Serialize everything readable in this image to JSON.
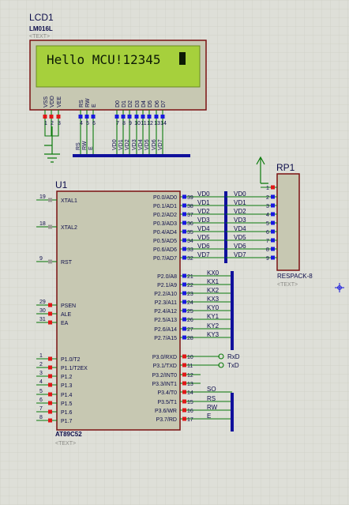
{
  "colors": {
    "background": "#dedfd8",
    "grid": "#cdcfc4",
    "body": "#c7c8b2",
    "body_border": "#7a1111",
    "wire": "#0b7a0b",
    "bus": "#10109c",
    "pin_red": "#e01818",
    "pin_blue": "#1818e0",
    "lcd_screen": "#a6d03c",
    "lcd_text": "#0d1a05",
    "text": "#0c0c4a",
    "muted": "#8b8b86"
  },
  "lcd": {
    "ref": "LCD1",
    "model": "LM016L",
    "text_placeholder": "<TEXT>",
    "display": "Hello MCU!12345",
    "pin_labels": [
      "VSS",
      "VDD",
      "VEE",
      "RS",
      "RW",
      "E",
      "D0",
      "D1",
      "D2",
      "D3",
      "D4",
      "D5",
      "D6",
      "D7"
    ],
    "pin_numbers": [
      "1",
      "2",
      "3",
      "4",
      "5",
      "6",
      "7",
      "8",
      "9",
      "10",
      "11",
      "12",
      "13",
      "14"
    ],
    "net_labels": [
      "RS",
      "RW",
      "E",
      "VD0",
      "VD1",
      "VD2",
      "VD3",
      "VD4",
      "VD5",
      "VD6",
      "VD7"
    ]
  },
  "mcu": {
    "ref": "U1",
    "model": "AT89C52",
    "text_placeholder": "<TEXT>",
    "left_pins": [
      {
        "num": "19",
        "name": "XTAL1"
      },
      {
        "num": "18",
        "name": "XTAL2"
      },
      {
        "num": "9",
        "name": "RST"
      },
      {
        "num": "29",
        "name": "PSEN"
      },
      {
        "num": "30",
        "name": "ALE"
      },
      {
        "num": "31",
        "name": "EA"
      },
      {
        "num": "1",
        "name": "P1.0/T2"
      },
      {
        "num": "2",
        "name": "P1.1/T2EX"
      },
      {
        "num": "3",
        "name": "P1.2"
      },
      {
        "num": "4",
        "name": "P1.3"
      },
      {
        "num": "5",
        "name": "P1.4"
      },
      {
        "num": "6",
        "name": "P1.5"
      },
      {
        "num": "7",
        "name": "P1.6"
      },
      {
        "num": "8",
        "name": "P1.7"
      }
    ],
    "right_pins": [
      {
        "num": "39",
        "name": "P0.0/AD0",
        "net": "VD0"
      },
      {
        "num": "38",
        "name": "P0.1/AD1",
        "net": "VD1"
      },
      {
        "num": "37",
        "name": "P0.2/AD2",
        "net": "VD2"
      },
      {
        "num": "36",
        "name": "P0.3/AD3",
        "net": "VD3"
      },
      {
        "num": "35",
        "name": "P0.4/AD4",
        "net": "VD4"
      },
      {
        "num": "34",
        "name": "P0.5/AD5",
        "net": "VD5"
      },
      {
        "num": "33",
        "name": "P0.6/AD6",
        "net": "VD6"
      },
      {
        "num": "32",
        "name": "P0.7/AD7",
        "net": "VD7"
      },
      {
        "num": "21",
        "name": "P2.0/A8",
        "net": "KX0"
      },
      {
        "num": "22",
        "name": "P2.1/A9",
        "net": "KX1"
      },
      {
        "num": "23",
        "name": "P2.2/A10",
        "net": "KX2"
      },
      {
        "num": "24",
        "name": "P2.3/A11",
        "net": "KX3"
      },
      {
        "num": "25",
        "name": "P2.4/A12",
        "net": "KY0"
      },
      {
        "num": "26",
        "name": "P2.5/A13",
        "net": "KY1"
      },
      {
        "num": "27",
        "name": "P2.6/A14",
        "net": "KY2"
      },
      {
        "num": "28",
        "name": "P2.7/A15",
        "net": "KY3"
      },
      {
        "num": "10",
        "name": "P3.0/RXD",
        "net": "RxD"
      },
      {
        "num": "11",
        "name": "P3.1/TXD",
        "net": "TxD"
      },
      {
        "num": "12",
        "name": "P3.2/INT0",
        "net": ""
      },
      {
        "num": "13",
        "name": "P3.3/INT1",
        "net": ""
      },
      {
        "num": "14",
        "name": "P3.4/T0",
        "net": "SO"
      },
      {
        "num": "15",
        "name": "P3.5/T1",
        "net": "RS"
      },
      {
        "num": "16",
        "name": "P3.6/WR",
        "net": "RW"
      },
      {
        "num": "17",
        "name": "P3.7/RD",
        "net": "E"
      }
    ]
  },
  "rp": {
    "ref": "RP1",
    "model": "RESPACK-8",
    "text_placeholder": "<TEXT>",
    "pins": [
      {
        "num": "1",
        "net": ""
      },
      {
        "num": "2",
        "net": "VD0"
      },
      {
        "num": "3",
        "net": "VD1"
      },
      {
        "num": "4",
        "net": "VD2"
      },
      {
        "num": "5",
        "net": "VD3"
      },
      {
        "num": "6",
        "net": "VD4"
      },
      {
        "num": "7",
        "net": "VD5"
      },
      {
        "num": "8",
        "net": "VD6"
      },
      {
        "num": "9",
        "net": "VD7"
      }
    ]
  },
  "icons": [
    "ground-icon",
    "power-arrow-icon",
    "origin-marker-icon"
  ]
}
